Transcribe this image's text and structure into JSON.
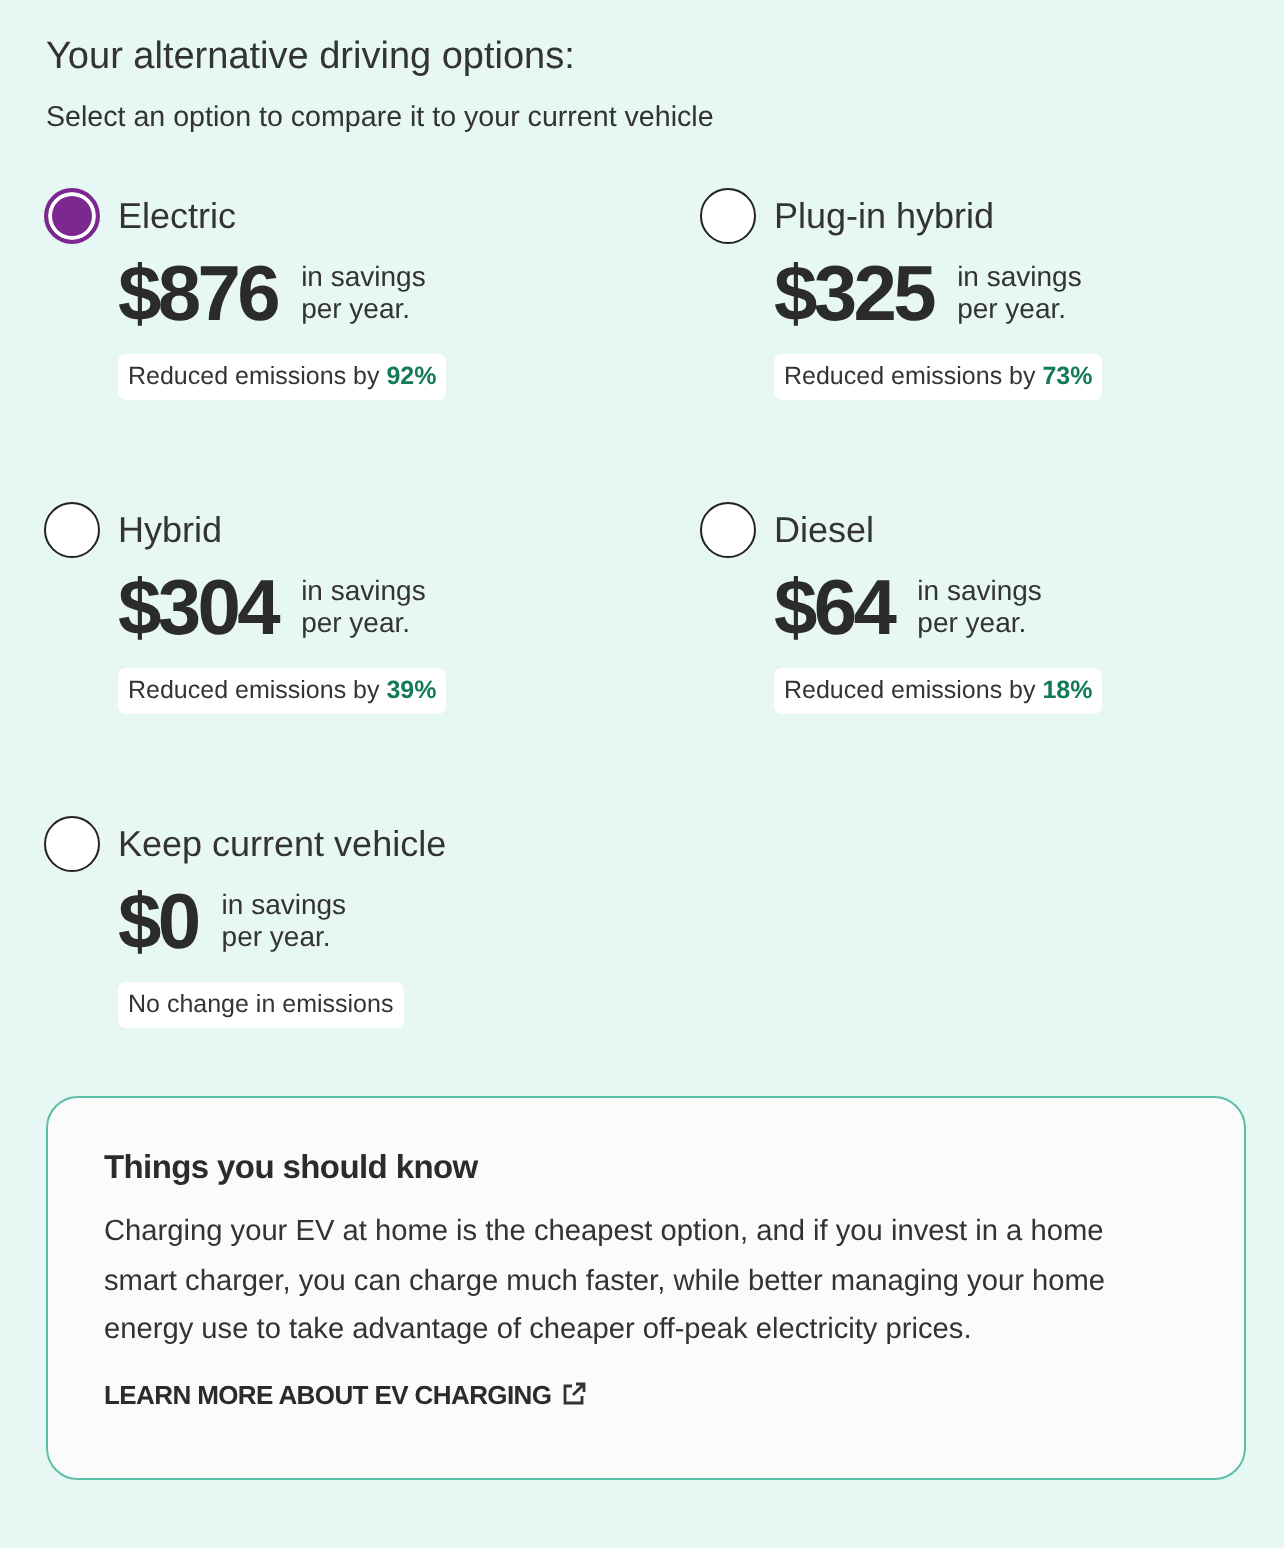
{
  "heading": "Your alternative driving options:",
  "subheading": "Select an option to compare it to your current vehicle",
  "options": [
    {
      "label": "Electric",
      "selected": true,
      "amount": "$876",
      "amount_note": "in savings per year.",
      "emissions": "Reduced emissions by **92%**"
    },
    {
      "label": "Plug-in hybrid",
      "selected": false,
      "amount": "$325",
      "amount_note": "in savings per year.",
      "emissions": "Reduced emissions by **73%**"
    },
    {
      "label": "Hybrid",
      "selected": false,
      "amount": "$304",
      "amount_note": "in savings per year.",
      "emissions": "Reduced emissions by **39%**"
    },
    {
      "label": "Diesel",
      "selected": false,
      "amount": "$64",
      "amount_note": "in savings per year.",
      "emissions": "Reduced emissions by **18%**"
    },
    {
      "label": "Keep current vehicle",
      "selected": false,
      "amount": "$0",
      "amount_note": "in savings per year.",
      "emissions": "No change in emissions"
    }
  ],
  "info_card": {
    "title": "Things you should know",
    "body": "Charging your EV at home is the cheapest option, and if you invest in a home smart charger, you can charge much faster, while better managing your home energy use to take advantage of cheaper off-peak electricity prices.",
    "link": "LEARN MORE ABOUT EV CHARGING"
  }
}
